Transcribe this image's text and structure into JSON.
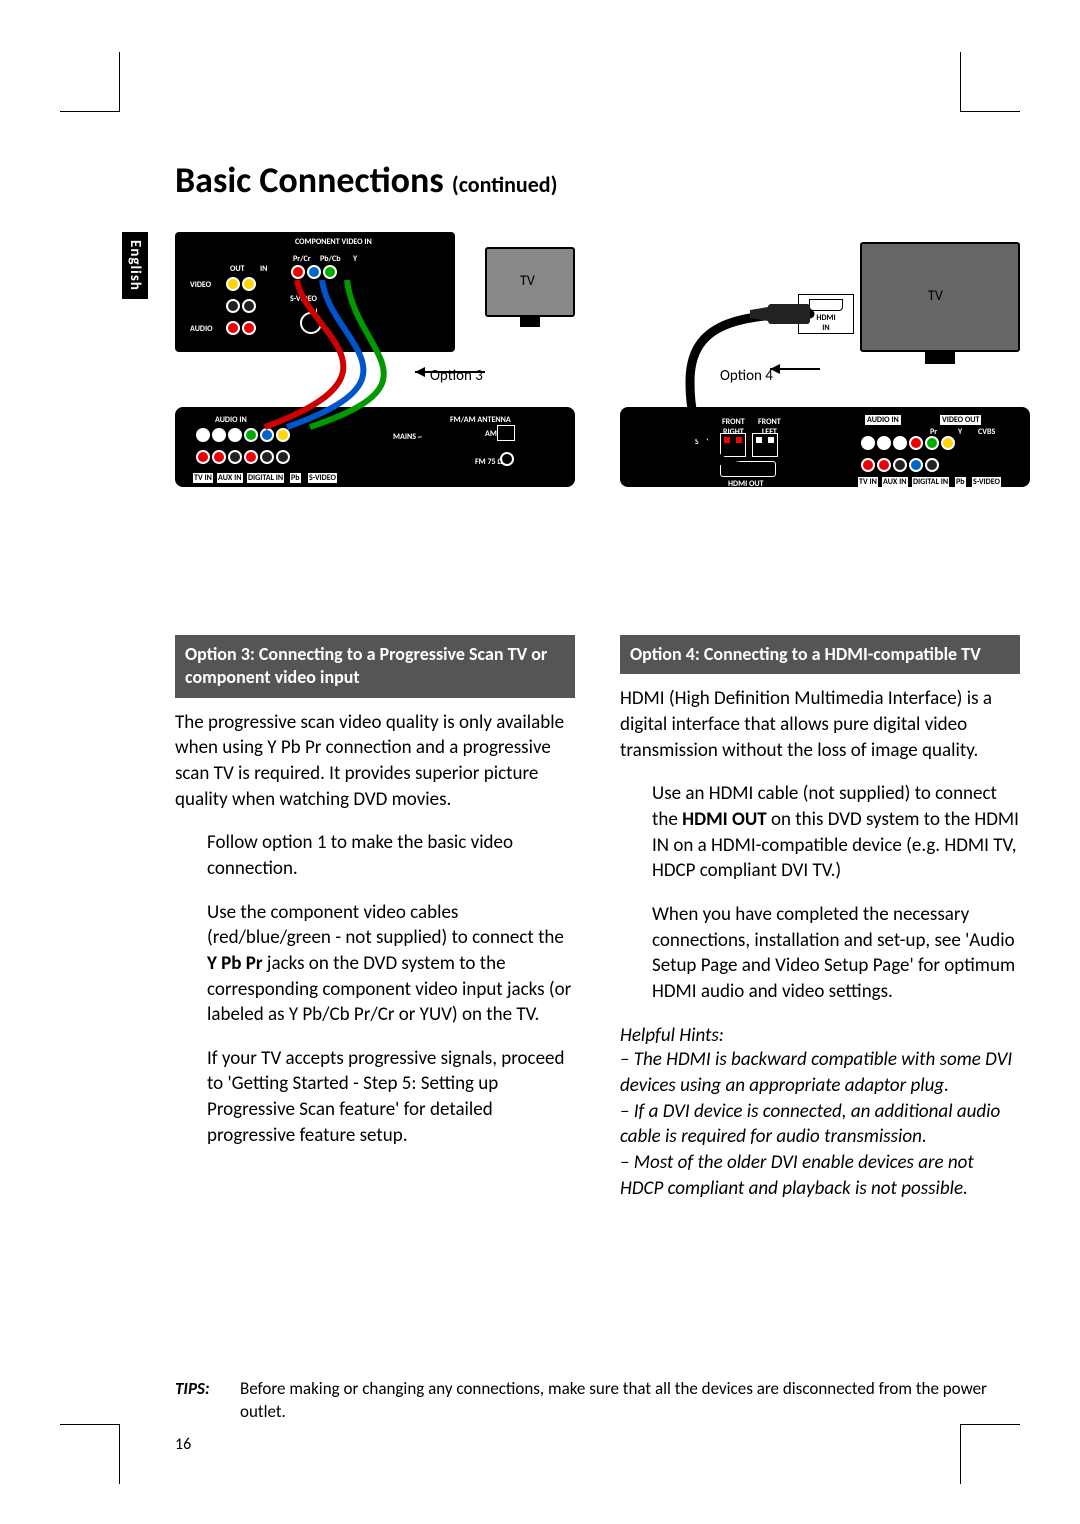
{
  "page": {
    "title_main": "Basic Connections",
    "title_sub": "(continued)",
    "language_tab": "English",
    "page_number": "16"
  },
  "diagrams": {
    "left": {
      "tv_label": "TV",
      "option_label": "Option 3",
      "panels": {
        "top": {
          "component_video_in": "COMPONENT\nVIDEO IN",
          "pr_cr": "Pr/Cr",
          "pb_cb": "Pb/Cb",
          "y": "Y",
          "out": "OUT",
          "in": "IN",
          "video": "VIDEO",
          "svideo": "S-VIDEO",
          "svideo_in": "IN",
          "audio": "AUDIO"
        },
        "bottom": {
          "audio_in": "AUDIO IN",
          "fm_am_antenna": "FM/AM ANTENNA",
          "mains": "MAINS ~",
          "am": "AM",
          "fm_75": "FM 75 Ω",
          "tv_in": "TV IN",
          "aux_in": "AUX IN",
          "digital_in": "DIGITAL IN",
          "pb": "Pb",
          "s_video": "S-VIDEO"
        }
      }
    },
    "right": {
      "tv_label": "TV",
      "option_label": "Option 4",
      "hdmi_in": "HDMI\nIN",
      "panels": {
        "bottom": {
          "front_right": "FRONT\nRIGHT",
          "front_left": "FRONT\nLEFT",
          "sub": "SUB",
          "hdmi_out": "HDMI OUT",
          "audio_in": "AUDIO IN",
          "video_out": "VIDEO OUT",
          "pr": "Pr",
          "y": "Y",
          "cvbs": "CVBS",
          "tv_in": "TV IN",
          "aux_in": "AUX IN",
          "digital_in": "DIGITAL IN",
          "pb": "Pb",
          "s_video": "S-VIDEO"
        }
      }
    }
  },
  "left_column": {
    "header": "Option 3: Connecting to a Progressive Scan TV or component video input",
    "intro": "The progressive scan video quality is only available when using Y Pb Pr connection and a progressive scan TV is required. It provides superior picture quality when watching DVD movies.",
    "step1": "Follow option 1 to make the basic video connection.",
    "step2_a": "Use the component video cables (red/blue/green - not supplied) to connect the ",
    "step2_b": "Y Pb Pr",
    "step2_c": " jacks on the DVD system to the corresponding component video input jacks (or labeled as Y Pb/Cb Pr/Cr or YUV) on the TV.",
    "step3": "If your TV accepts progressive signals, proceed to 'Getting Started - Step 5: Setting up Progressive Scan feature' for detailed progressive feature setup."
  },
  "right_column": {
    "header": "Option 4: Connecting to a HDMI-compatible TV",
    "intro": "HDMI (High Definition Multimedia Interface) is a digital interface that allows pure digital video transmission without the loss of image quality.",
    "step1_a": "Use an HDMI cable (not supplied) to connect the ",
    "step1_b": "HDMI OUT",
    "step1_c": " on this DVD system to the HDMI IN on a HDMI-compatible device (e.g. HDMI TV, HDCP compliant DVI TV.)",
    "step2": "When you have completed the necessary connections, installation and set-up, see 'Audio Setup Page and Video Setup Page' for optimum HDMI audio and video settings.",
    "hints_title": "Helpful Hints:",
    "hint1": "– The HDMI is backward compatible with some DVI devices using an appropriate adaptor plug.",
    "hint2": "– If a DVI device is connected, an additional audio cable is required for audio transmission.",
    "hint3": "– Most of the older DVI enable devices are not HDCP compliant and playback is not possible."
  },
  "tips": {
    "label": "TIPS:",
    "text": "Before making or changing any connections, make sure that all the devices are disconnected from the power outlet."
  }
}
